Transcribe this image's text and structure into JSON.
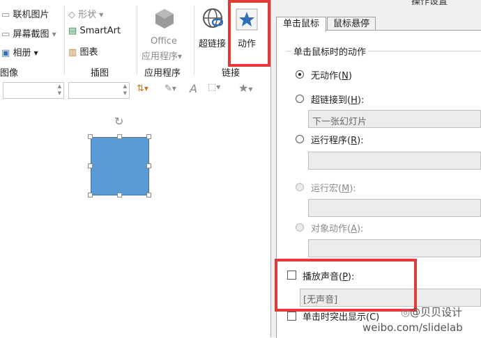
{
  "ribbon": {
    "images_group": {
      "online_pictures": "联机图片",
      "screenshot": "屏幕截图",
      "album": "相册",
      "label": "图像"
    },
    "illustrations_group": {
      "shapes": "形状",
      "smartart": "SmartArt",
      "chart": "图表",
      "label": "插图"
    },
    "apps_group": {
      "office_line1": "Office",
      "office_line2": "应用程序",
      "label": "应用程序"
    },
    "links_group": {
      "hyperlink": "超链接",
      "action": "动作",
      "label": "链接"
    }
  },
  "dialog": {
    "title_partial": "操作设置",
    "tabs": [
      "单击鼠标",
      "鼠标悬停"
    ],
    "section_title": "单击鼠标时的动作",
    "options": {
      "none": {
        "label": "无动作(",
        "key": "N",
        "tail": ")"
      },
      "hyperlink": {
        "label": "超链接到(",
        "key": "H",
        "tail": "):"
      },
      "run_program": {
        "label": "运行程序(",
        "key": "R",
        "tail": "):"
      },
      "run_macro": {
        "label": "运行宏(",
        "key": "M",
        "tail": "):"
      },
      "object_action": {
        "label": "对象动作(",
        "key": "A",
        "tail": "):"
      }
    },
    "hyperlink_value": "下一张幻灯片",
    "play_sound": {
      "label": "播放声音(",
      "key": "P",
      "tail": "):"
    },
    "sound_value": "[无声音]",
    "highlight": "单击时突出显示(C)"
  },
  "watermark": {
    "handle": "@贝贝设计",
    "url": "weibo.com/slidelab"
  },
  "colors": {
    "highlight_red": "#e03a3a",
    "shape_fill": "#5b9bd5",
    "action_star": "#2e6fb5"
  }
}
